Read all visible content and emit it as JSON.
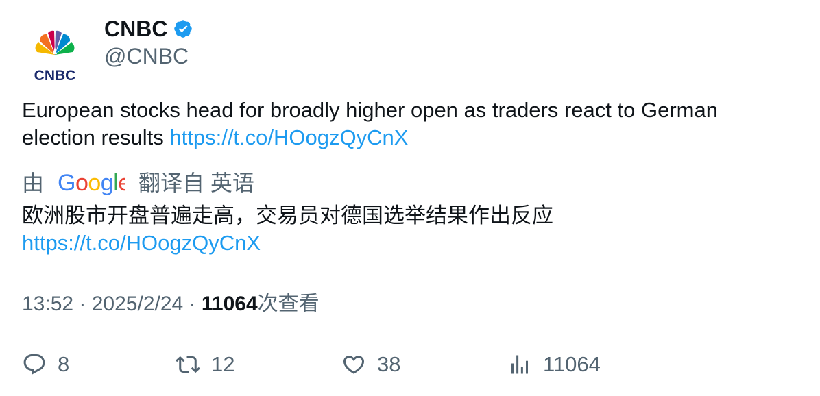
{
  "author": {
    "display_name": "CNBC",
    "handle": "@CNBC",
    "avatar_logo_text": "CNBC",
    "verified_color": "#1d9bf0"
  },
  "tweet": {
    "text": "European stocks head for broadly higher open as traders react to German election results ",
    "link": "https://t.co/HOogzQyCnX"
  },
  "translation": {
    "prefix": "由",
    "provider_logo": "Google",
    "suffix": "翻译自 英语",
    "text": "欧洲股市开盘普遍走高，交易员对德国选举结果作出反应",
    "link": "https://t.co/HOogzQyCnX"
  },
  "meta": {
    "time": "13:52",
    "sep1": " · ",
    "date": "2025/2/24",
    "sep2": " · ",
    "views_count": "11064",
    "views_label": "次查看"
  },
  "actions": {
    "replies": "8",
    "retweets": "12",
    "likes": "38",
    "views": "11064"
  },
  "colors": {
    "text": "#0f1419",
    "secondary": "#536471",
    "link": "#1d9bf0"
  }
}
